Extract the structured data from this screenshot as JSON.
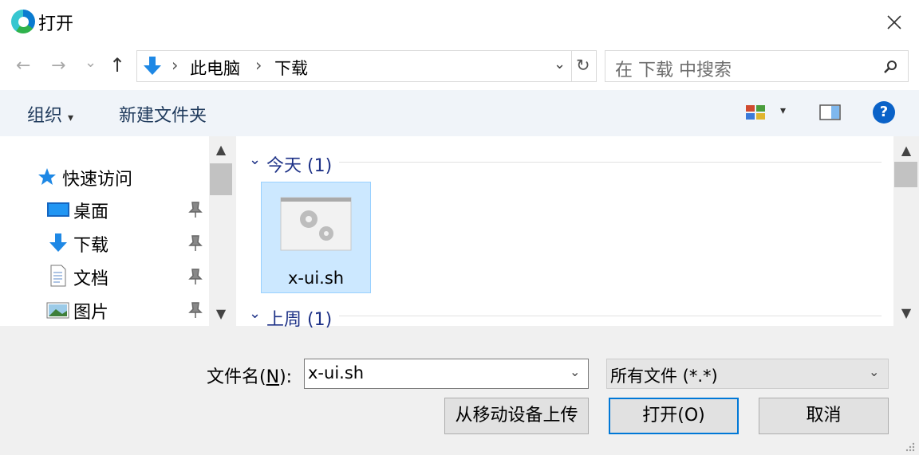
{
  "window": {
    "title": "打开",
    "close_glyph": "✕"
  },
  "nav": {
    "back_glyph": "←",
    "forward_glyph": "→",
    "recent_glyph": "⌄",
    "up_glyph": "↑"
  },
  "address": {
    "separator": "›",
    "crumbs": [
      "此电脑",
      "下载"
    ],
    "dropdown_glyph": "⌄",
    "refresh_glyph": "↻"
  },
  "search": {
    "placeholder": "在 下载 中搜索"
  },
  "toolbar": {
    "organize_label": "组织",
    "organize_caret": "▾",
    "new_folder_label": "新建文件夹",
    "view_caret": "▾",
    "help_glyph": "?"
  },
  "sidebar": {
    "quick_access": "快速访问",
    "items": [
      {
        "label": "桌面",
        "icon": "desktop-icon"
      },
      {
        "label": "下载",
        "icon": "download-icon"
      },
      {
        "label": "文档",
        "icon": "document-icon"
      },
      {
        "label": "图片",
        "icon": "pictures-icon"
      }
    ]
  },
  "groups": [
    {
      "title": "今天 (1)",
      "chevron": "⌄"
    },
    {
      "title": "上周 (1)",
      "chevron": "⌄"
    }
  ],
  "files": [
    {
      "name": "x-ui.sh",
      "icon": "script-file-icon",
      "selected": true
    }
  ],
  "bottom": {
    "filename_label_pre": "文件名(",
    "filename_label_key": "N",
    "filename_label_post": "):",
    "filename_value": "x-ui.sh",
    "filetype_value": "所有文件 (*.*)",
    "upload_label": "从移动设备上传",
    "open_label": "打开(O)",
    "cancel_label": "取消"
  },
  "colors": {
    "accent": "#0078d7",
    "selection": "#cce8ff",
    "group_title": "#1e3287"
  }
}
